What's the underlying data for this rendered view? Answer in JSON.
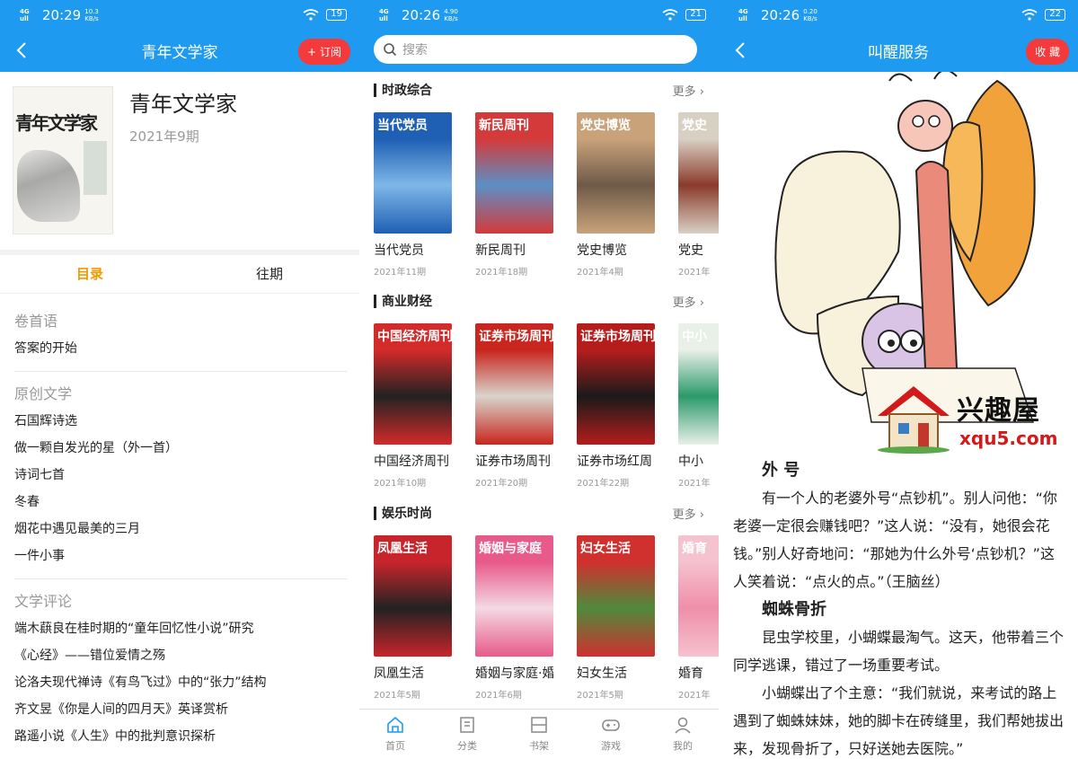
{
  "panel1": {
    "status": {
      "network": "4GHD",
      "time": "20:29",
      "speed": "10.3 KB/s",
      "battery": "19"
    },
    "title": "青年文学家",
    "subscribe": "+ 订阅",
    "cover_text": "青年文学家",
    "mag_title": "青年文学家",
    "mag_issue": "2021年9期",
    "tabs": [
      "目录",
      "往期"
    ],
    "sections": [
      {
        "title": "卷首语",
        "items": [
          "答案的开始"
        ]
      },
      {
        "title": "原创文学",
        "items": [
          "石国辉诗选",
          "做一颗自发光的星（外一首）",
          "诗词七首",
          "冬春",
          "烟花中遇见最美的三月",
          "一件小事"
        ]
      },
      {
        "title": "文学评论",
        "items": [
          "端木蕻良在桂时期的“童年回忆性小说”研究",
          "《心经》——错位爱情之殇",
          "论洛夫现代禅诗《有鸟飞过》中的“张力”结构",
          "齐文昱《你是人间的四月天》英译赏析",
          "路遥小说《人生》中的批判意识探析"
        ]
      }
    ]
  },
  "panel2": {
    "status": {
      "network": "4GHD",
      "time": "20:26",
      "speed": "4.90 KB/s",
      "battery": "21"
    },
    "search_placeholder": "搜索",
    "more": "更多",
    "sections": [
      {
        "name": "时政综合",
        "books": [
          {
            "name": "当代党员",
            "date": "2021年11期",
            "mast": "当代党员",
            "color": "#1f5fb4",
            "color2": "#7fb7e8"
          },
          {
            "name": "新民周刊",
            "date": "2021年18期",
            "mast": "新民周刊",
            "color": "#d43a3a",
            "color2": "#5c8fc5"
          },
          {
            "name": "党史博览",
            "date": "2021年4期",
            "mast": "党史博览",
            "color": "#c9a27a",
            "color2": "#6e5a48"
          },
          {
            "name": "党史",
            "date": "2021年",
            "mast": "党史",
            "color": "#d9d0c4",
            "color2": "#8a3b2b"
          }
        ]
      },
      {
        "name": "商业财经",
        "books": [
          {
            "name": "中国经济周刊",
            "date": "2021年10期",
            "mast": "中国经济周刊",
            "color": "#d32a2a",
            "color2": "#222222"
          },
          {
            "name": "证券市场周刊",
            "date": "2021年20期",
            "mast": "证券市场周刊",
            "color": "#c8261e",
            "color2": "#d8d4cc"
          },
          {
            "name": "证券市场红周",
            "date": "2021年22期",
            "mast": "证券市场周刊",
            "color": "#b51d1d",
            "color2": "#1a1a1a"
          },
          {
            "name": "中小",
            "date": "2021年",
            "mast": "中小",
            "color": "#e8f0e8",
            "color2": "#2b9a6a"
          }
        ]
      },
      {
        "name": "娱乐时尚",
        "books": [
          {
            "name": "凤凰生活",
            "date": "2021年5期",
            "mast": "凤凰生活",
            "color": "#c7252b",
            "color2": "#222222"
          },
          {
            "name": "婚姻与家庭·婚",
            "date": "2021年6期",
            "mast": "婚姻与家庭",
            "color": "#e85a8a",
            "color2": "#f3d9e3"
          },
          {
            "name": "妇女生活",
            "date": "2021年5期",
            "mast": "妇女生活",
            "color": "#d0302e",
            "color2": "#4f8a3c"
          },
          {
            "name": "婚育",
            "date": "2021年",
            "mast": "婚育",
            "color": "#f5c2cf",
            "color2": "#ef8fa9"
          }
        ]
      }
    ],
    "tabbar": [
      "首页",
      "分类",
      "书架",
      "游戏",
      "我的"
    ]
  },
  "panel3": {
    "status": {
      "network": "4GHD",
      "time": "20:26",
      "speed": "0.20 KB/s",
      "battery": "22"
    },
    "title": "叫醒服务",
    "collect": "收 藏",
    "logo_cn": "兴趣屋",
    "logo_url": "xqu5.com",
    "heading1": "外 号",
    "para1": "有一个人的老婆外号“点钞机”。别人问他：“你老婆一定很会赚钱吧？”这人说：“没有，她很会花钱。”别人好奇地问：“那她为什么外号‘点钞机？”这人笑着说：“点火的点。”（王脑丝）",
    "heading2": "蜘蛛骨折",
    "para2": "昆虫学校里，小蝴蝶最淘气。这天，他带着三个同学逃课，错过了一场重要考试。",
    "para3": "小蝴蝶出了个主意：“我们就说，来考试的路上遇到了蜘蛛妹妹，她的脚卡在砖缝里，我们帮她拔出来，发现骨折了，只好送她去医院。”"
  }
}
